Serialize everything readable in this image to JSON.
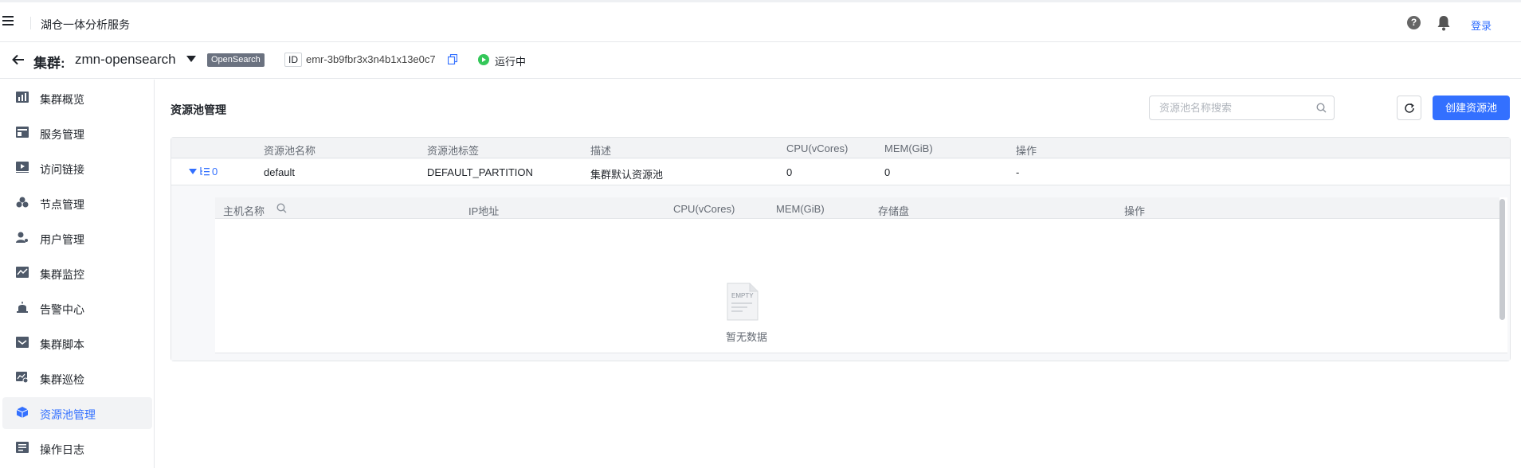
{
  "header": {
    "app_title": "湖仓一体分析服务",
    "login_label": "登录",
    "help_glyph": "?"
  },
  "cluster": {
    "label": "集群:",
    "name": "zmn-opensearch",
    "type_badge": "OpenSearch",
    "id_tag": "ID",
    "id_value": "emr-3b9fbr3x3n4b1x13e0c7",
    "status": "运行中",
    "status_color": "#34c759"
  },
  "sidebar": {
    "items": [
      {
        "label": "集群概览",
        "icon": "chart-icon"
      },
      {
        "label": "服务管理",
        "icon": "service-icon"
      },
      {
        "label": "访问链接",
        "icon": "play-icon"
      },
      {
        "label": "节点管理",
        "icon": "nodes-icon"
      },
      {
        "label": "用户管理",
        "icon": "user-icon"
      },
      {
        "label": "集群监控",
        "icon": "monitor-icon"
      },
      {
        "label": "告警中心",
        "icon": "alarm-icon"
      },
      {
        "label": "集群脚本",
        "icon": "script-icon"
      },
      {
        "label": "集群巡检",
        "icon": "inspect-icon"
      },
      {
        "label": "资源池管理",
        "icon": "cube-icon",
        "active": true
      },
      {
        "label": "操作日志",
        "icon": "log-icon"
      }
    ]
  },
  "main": {
    "title": "资源池管理",
    "search_placeholder": "资源池名称搜索",
    "create_label": "创建资源池",
    "accent": "#3370ff"
  },
  "pool_table": {
    "columns": [
      "资源池名称",
      "资源池标签",
      "描述",
      "CPU(vCores)",
      "MEM(GiB)",
      "操作"
    ],
    "rows": [
      {
        "count": "0",
        "name": "default",
        "tag": "DEFAULT_PARTITION",
        "desc": "集群默认资源池",
        "cpu": "0",
        "mem": "0",
        "ops": "-"
      }
    ]
  },
  "host_table": {
    "columns": [
      "主机名称",
      "IP地址",
      "CPU(vCores)",
      "MEM(GiB)",
      "存储盘",
      "操作"
    ],
    "empty_text": "暂无数据",
    "empty_icon_text": "EMPTY"
  }
}
